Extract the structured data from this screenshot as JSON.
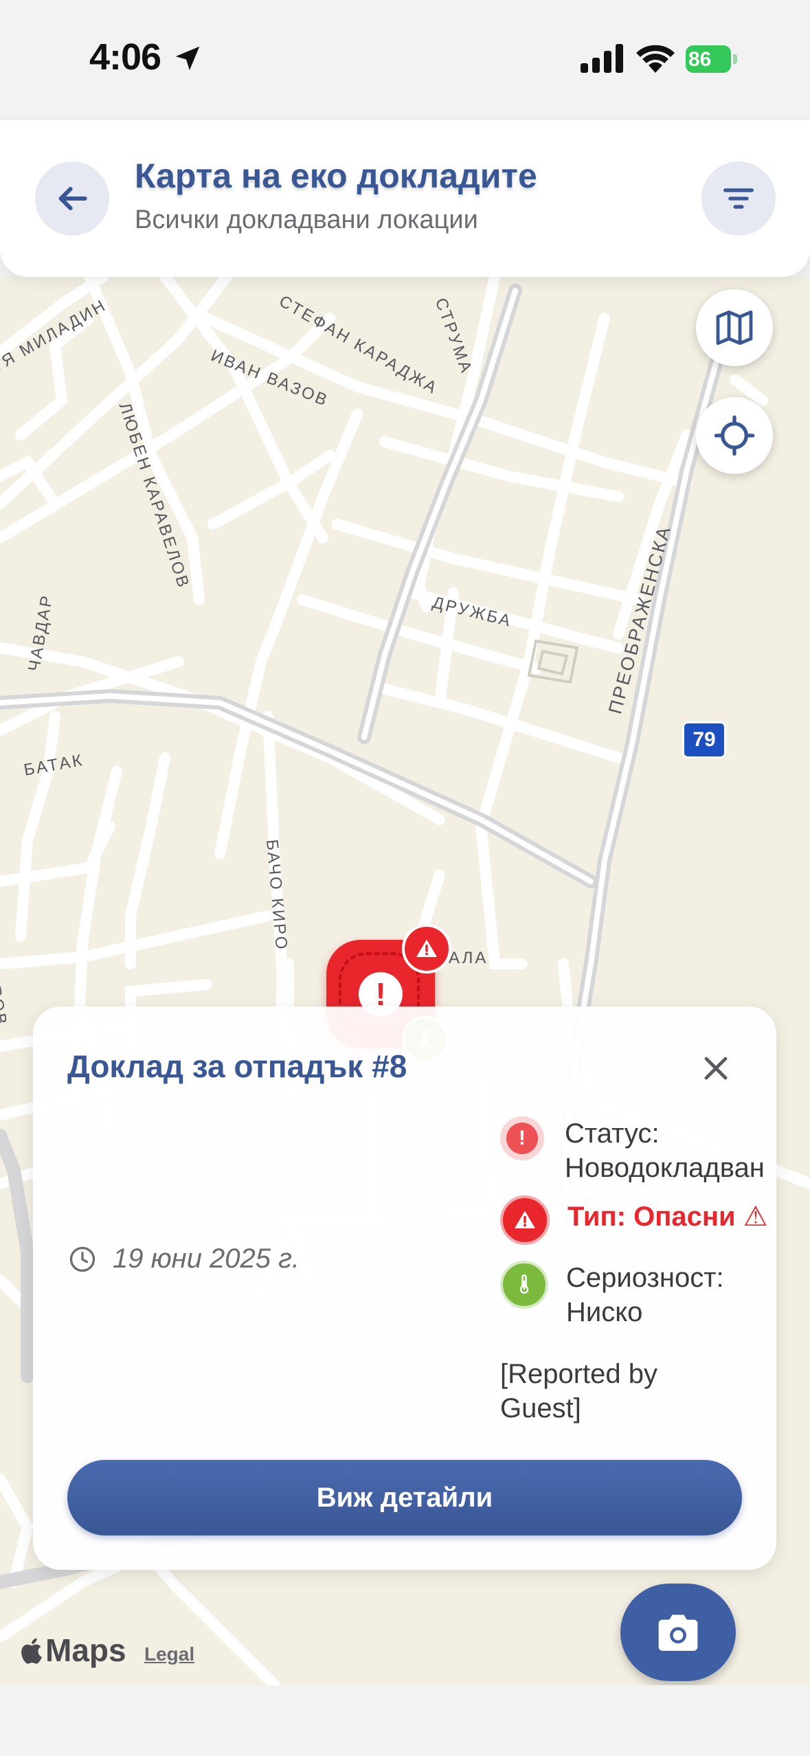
{
  "status_bar": {
    "time": "4:06",
    "battery": "86"
  },
  "header": {
    "title": "Карта на еко докладите",
    "subtitle": "Всички докладвани локации"
  },
  "map": {
    "street_labels": [
      "ИВАН ВАЗОВ",
      "СТЕФАН КАРАДЖА",
      "СТРУМА",
      "ЛЮБЕН КАРАВЕЛОВ",
      "ДРУЖБА",
      "ПРЕОБРАЖЕНСКА",
      "ЧАВДАР",
      "БАТАК",
      "БАЧО КИРО",
      "МУСАЛА",
      "ТЯ МИЛАДИН",
      "АРОВ"
    ],
    "route_badge": "79",
    "colors": {
      "land": "#f3efe3",
      "road": "#ffffff",
      "major_road": "#d6d6d9"
    }
  },
  "card": {
    "title": "Доклад за отпадък #8",
    "date": "19 юни 2025 г.",
    "status_text": "Статус:\nНоводокладван",
    "type_text": "Тип: Опасни ⚠",
    "severity_text": "Сериозност:\nНиско",
    "reported_by": "[Reported by\nGuest]",
    "details_button": "Виж детайли"
  },
  "footer": {
    "maps_label": "Maps",
    "legal_label": "Legal"
  },
  "colors": {
    "primary": "#3a5795",
    "danger": "#e8262c",
    "success": "#7cba3d"
  },
  "icons": [
    "location-arrow-icon",
    "signal-icon",
    "wifi-icon",
    "back-arrow-icon",
    "filter-icon",
    "map-layers-icon",
    "locate-icon",
    "exclamation-icon",
    "warning-icon",
    "thermometer-icon",
    "close-icon",
    "clock-icon",
    "camera-icon",
    "apple-icon"
  ]
}
